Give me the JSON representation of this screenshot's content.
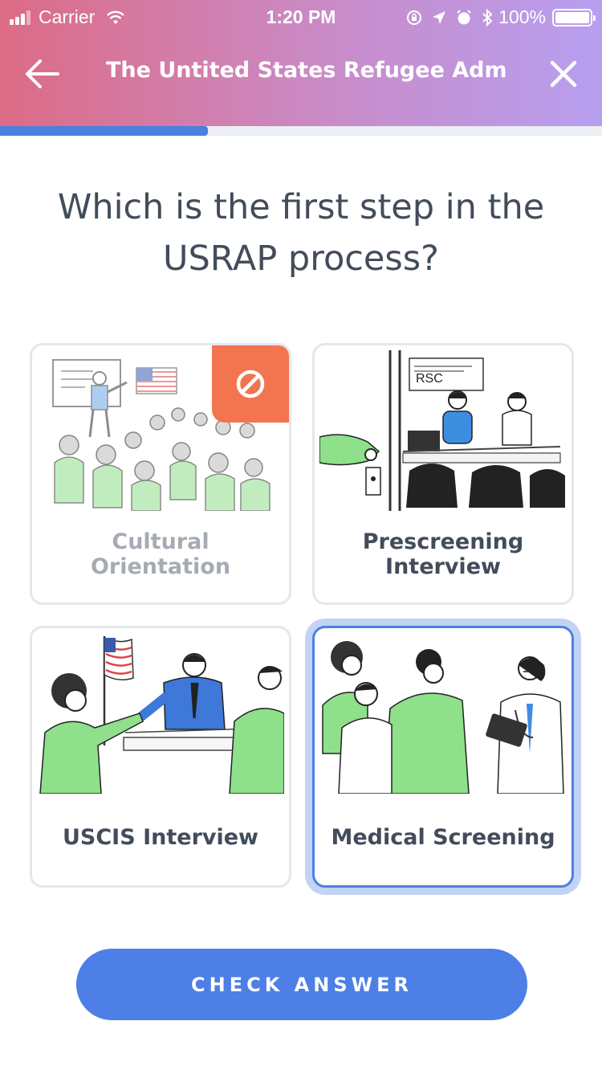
{
  "status_bar": {
    "carrier": "Carrier",
    "time": "1:20 PM",
    "battery": "100%",
    "icons": [
      "signal-icon",
      "wifi-icon",
      "orientation-lock-icon",
      "location-icon",
      "alarm-icon",
      "bluetooth-icon",
      "battery-icon"
    ]
  },
  "nav": {
    "title": "The Untited States Refugee Adm...",
    "back_icon": "arrow-left-icon",
    "close_icon": "close-icon"
  },
  "progress": {
    "fraction": 0.345
  },
  "question": "Which is the first step in the USRAP process?",
  "options": [
    {
      "label": "Cultural Orientation",
      "state": "disabled",
      "badge": "ban-icon"
    },
    {
      "label": "Prescreening Interview",
      "state": "default",
      "sign_text": "RSC"
    },
    {
      "label": "USCIS Interview",
      "state": "default"
    },
    {
      "label": "Medical Screening",
      "state": "selected"
    }
  ],
  "check_button": "CHECK ANSWER",
  "colors": {
    "gradient_start": "#dd6b85",
    "gradient_end": "#b79ff0",
    "accent": "#4d7fe6",
    "selected_ring": "#c3d3f4",
    "ban_badge": "#f2754f",
    "illustration_green": "#8fe08a"
  }
}
